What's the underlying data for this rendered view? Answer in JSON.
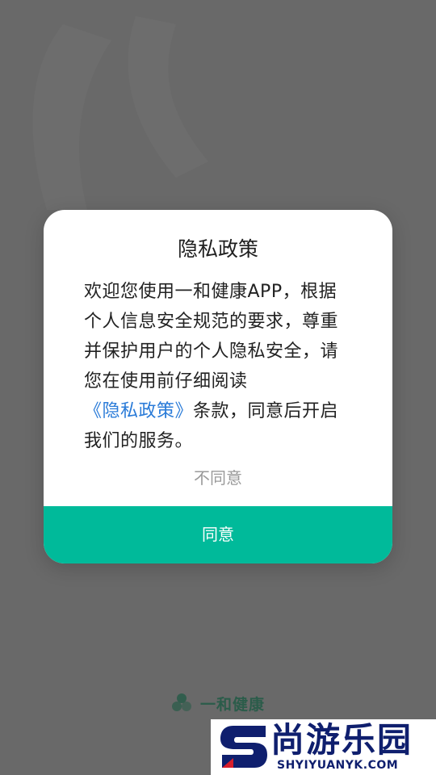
{
  "dialog": {
    "title": "隐私政策",
    "body_before": "欢迎您使用一和健康APP，根据个人信息安全规范的要求，尊重并保护用户的个人隐私安全，请您在使用前仔细阅读",
    "policy_link": "《隐私政策》",
    "body_after": "条款，同意后开启我们的服务。",
    "disagree_label": "不同意",
    "agree_label": "同意"
  },
  "brand": {
    "name": "一和健康",
    "logo_icon": "clover-logo-icon"
  },
  "watermark": {
    "title": "尚游乐园",
    "url": "SHYIYUANYK.COM",
    "logo_icon": "s-logo-icon"
  },
  "colors": {
    "overlay": "#696969",
    "accent": "#00ba9a",
    "link": "#2a7bd8",
    "watermark": "#0f1f6e"
  }
}
